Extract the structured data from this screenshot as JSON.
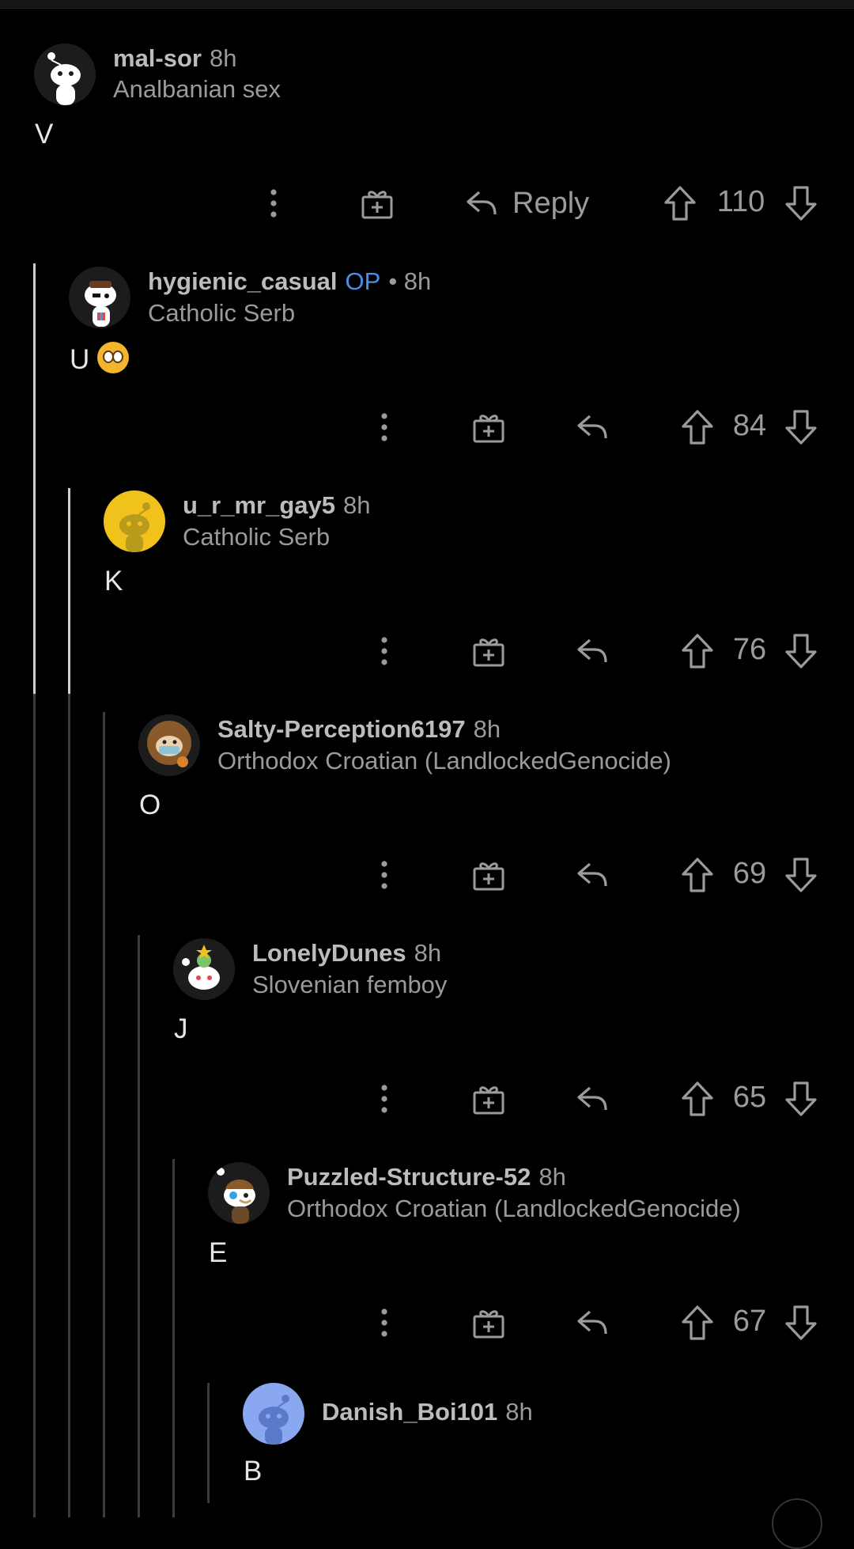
{
  "comments": [
    {
      "username": "mal-sor",
      "op": "",
      "time": "8h",
      "flair": "Analbanian sex",
      "text": "V",
      "reply_label": "Reply",
      "score": "110"
    },
    {
      "username": "hygienic_casual",
      "op": "OP",
      "time": "• 8h",
      "flair": "Catholic Serb",
      "text": "U",
      "score": "84"
    },
    {
      "username": "u_r_mr_gay5",
      "op": "",
      "time": "8h",
      "flair": "Catholic Serb",
      "text": "K",
      "score": "76"
    },
    {
      "username": "Salty-Perception6197",
      "op": "",
      "time": "8h",
      "flair": "Orthodox Croatian (LandlockedGenocide)",
      "text": "O",
      "score": "69"
    },
    {
      "username": "LonelyDunes",
      "op": "",
      "time": "8h",
      "flair": "Slovenian femboy",
      "text": "J",
      "score": "65"
    },
    {
      "username": "Puzzled-Structure-52",
      "op": "",
      "time": "8h",
      "flair": "Orthodox Croatian (LandlockedGenocide)",
      "text": "E",
      "score": "67"
    },
    {
      "username": "Danish_Boi101",
      "op": "",
      "time": "8h",
      "flair": "",
      "text": "B"
    }
  ],
  "icons": {
    "more": "more-options-icon",
    "award": "award-icon",
    "reply": "reply-icon",
    "upvote": "upvote-arrow-icon",
    "downvote": "downvote-arrow-icon",
    "emoji": "flushed-face-emoji"
  },
  "colors": {
    "background": "#000000",
    "op_badge": "#4a8fe7",
    "text": "#e6e6e6",
    "muted": "#9a9a9a"
  }
}
